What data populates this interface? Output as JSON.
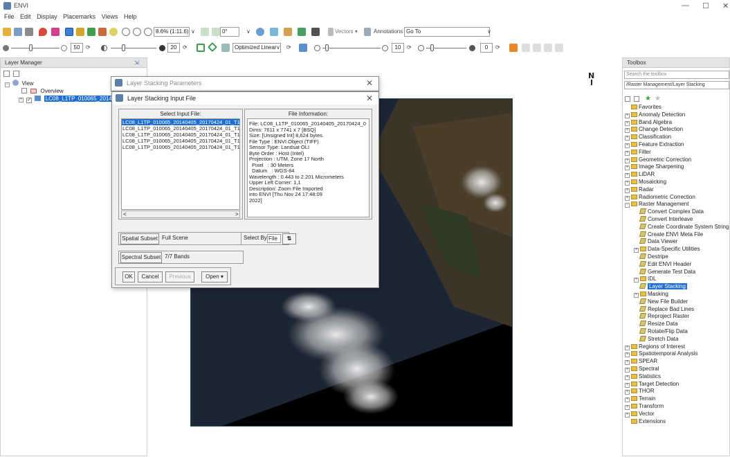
{
  "app": {
    "title": "ENVI",
    "minimize": "—",
    "maximize": "☐",
    "close": "✕"
  },
  "menu": [
    "File",
    "Edit",
    "Display",
    "Placemarks",
    "Views",
    "Help"
  ],
  "toolbar": {
    "zoom_value": "8.6% (1:11.6)",
    "rotation_value": "0°",
    "vectors_label": "Vectors ▾",
    "annotations_label": "Annotations ▾",
    "goto_value": "Go To",
    "brightness_value": "50",
    "contrast_value": "20",
    "stretch_value": "Optimized Linear",
    "sharpen_value": "10",
    "transparency_value": "0"
  },
  "layer_manager": {
    "title": "Layer Manager",
    "root": "View",
    "overview": "Overview",
    "layer": "LC08_L1TP_010065_20140"
  },
  "north_arrow": "N",
  "toolbox": {
    "title": "Toolbox",
    "search_placeholder": "Search the toolbox",
    "path": "/Raster Management/Layer Stacking",
    "items": [
      {
        "label": "Favorites",
        "indent": 0,
        "kind": "folder",
        "pm": ""
      },
      {
        "label": "Anomaly Detection",
        "indent": 0,
        "kind": "folder",
        "pm": "+"
      },
      {
        "label": "Band Algebra",
        "indent": 0,
        "kind": "folder",
        "pm": "+"
      },
      {
        "label": "Change Detection",
        "indent": 0,
        "kind": "folder",
        "pm": "+"
      },
      {
        "label": "Classification",
        "indent": 0,
        "kind": "folder",
        "pm": "+"
      },
      {
        "label": "Feature Extraction",
        "indent": 0,
        "kind": "folder",
        "pm": "+"
      },
      {
        "label": "Filter",
        "indent": 0,
        "kind": "folder",
        "pm": "+"
      },
      {
        "label": "Geometric Correction",
        "indent": 0,
        "kind": "folder",
        "pm": "+"
      },
      {
        "label": "Image Sharpening",
        "indent": 0,
        "kind": "folder",
        "pm": "+"
      },
      {
        "label": "LiDAR",
        "indent": 0,
        "kind": "folder",
        "pm": "+"
      },
      {
        "label": "Mosaicking",
        "indent": 0,
        "kind": "folder",
        "pm": "+"
      },
      {
        "label": "Radar",
        "indent": 0,
        "kind": "folder",
        "pm": "+"
      },
      {
        "label": "Radiometric Correction",
        "indent": 0,
        "kind": "folder",
        "pm": "+"
      },
      {
        "label": "Raster Management",
        "indent": 0,
        "kind": "folder",
        "pm": "−"
      },
      {
        "label": "Convert Complex Data",
        "indent": 1,
        "kind": "tool",
        "pm": ""
      },
      {
        "label": "Convert Interleave",
        "indent": 1,
        "kind": "tool",
        "pm": ""
      },
      {
        "label": "Create Coordinate System String",
        "indent": 1,
        "kind": "tool",
        "pm": ""
      },
      {
        "label": "Create ENVI Meta File",
        "indent": 1,
        "kind": "tool",
        "pm": ""
      },
      {
        "label": "Data Viewer",
        "indent": 1,
        "kind": "tool",
        "pm": ""
      },
      {
        "label": "Data-Specific Utilities",
        "indent": 1,
        "kind": "folder",
        "pm": "+"
      },
      {
        "label": "Destripe",
        "indent": 1,
        "kind": "tool",
        "pm": ""
      },
      {
        "label": "Edit ENVI Header",
        "indent": 1,
        "kind": "tool",
        "pm": ""
      },
      {
        "label": "Generate Test Data",
        "indent": 1,
        "kind": "tool",
        "pm": ""
      },
      {
        "label": "IDL",
        "indent": 1,
        "kind": "folder",
        "pm": "+"
      },
      {
        "label": "Layer Stacking",
        "indent": 1,
        "kind": "tool",
        "pm": "",
        "selected": true
      },
      {
        "label": "Masking",
        "indent": 1,
        "kind": "folder",
        "pm": "+"
      },
      {
        "label": "New File Builder",
        "indent": 1,
        "kind": "tool",
        "pm": ""
      },
      {
        "label": "Replace Bad Lines",
        "indent": 1,
        "kind": "tool",
        "pm": ""
      },
      {
        "label": "Reproject Raster",
        "indent": 1,
        "kind": "tool",
        "pm": ""
      },
      {
        "label": "Resize Data",
        "indent": 1,
        "kind": "tool",
        "pm": ""
      },
      {
        "label": "Rotate/Flip Data",
        "indent": 1,
        "kind": "tool",
        "pm": ""
      },
      {
        "label": "Stretch Data",
        "indent": 1,
        "kind": "tool",
        "pm": ""
      },
      {
        "label": "Regions of Interest",
        "indent": 0,
        "kind": "folder",
        "pm": "+"
      },
      {
        "label": "Spatiotemporal Analysis",
        "indent": 0,
        "kind": "folder",
        "pm": "+"
      },
      {
        "label": "SPEAR",
        "indent": 0,
        "kind": "folder",
        "pm": "+"
      },
      {
        "label": "Spectral",
        "indent": 0,
        "kind": "folder",
        "pm": "+"
      },
      {
        "label": "Statistics",
        "indent": 0,
        "kind": "folder",
        "pm": "+"
      },
      {
        "label": "Target Detection",
        "indent": 0,
        "kind": "folder",
        "pm": "+"
      },
      {
        "label": "THOR",
        "indent": 0,
        "kind": "folder",
        "pm": "+"
      },
      {
        "label": "Terrain",
        "indent": 0,
        "kind": "folder",
        "pm": "+"
      },
      {
        "label": "Transform",
        "indent": 0,
        "kind": "folder",
        "pm": "+"
      },
      {
        "label": "Vector",
        "indent": 0,
        "kind": "folder",
        "pm": "+"
      },
      {
        "label": "Extensions",
        "indent": 0,
        "kind": "folder",
        "pm": ""
      }
    ]
  },
  "stack_params": {
    "title": "Layer Stacking Parameters",
    "close": "✕"
  },
  "input_dialog": {
    "title": "Layer Stacking Input File",
    "close": "✕",
    "select_header": "Select Input File:",
    "files": [
      "LC08_L1TP_010065_20140405_20170424_01_T1",
      "LC08_L1TP_010065_20140405_20170424_01_T1",
      "LC08_L1TP_010065_20140405_20170424_01_T1",
      "LC08_L1TP_010065_20140405_20170424_01_T1",
      "LC08_L1TP_010065_20140405_20170424_01_T1"
    ],
    "info_header": "File Information:",
    "info_lines": [
      "File: LC08_L1TP_010065_20140405_20170424_0",
      "Dims: 7611 x 7741 x 7 [BSQ]",
      "Size: [Unsigned Int] 8,624 bytes.",
      "File Type : ENVI Object (TIFF)",
      "Sensor Type: Landsat OLI",
      "Byte Order : Host (Intel)",
      "Projection : UTM, Zone 17 North",
      "  Pixel   : 30 Meters",
      "  Datum   : WGS-84",
      "Wavelength : 0.443 to 2.201 Micrometers",
      "Upper Left Corner: 1,1",
      "Description: Zoom File Imported",
      "into ENVI [Thu Nov 24 17:48:09",
      "2022]"
    ],
    "spatial_label": "Spatial Subset",
    "spatial_value": "Full Scene",
    "select_by_label": "Select By",
    "select_by_value": "File",
    "spectral_label": "Spectral Subset",
    "spectral_value": "7/7 Bands",
    "ok": "OK",
    "cancel": "Cancel",
    "previous": "Previous",
    "open": "Open ▾"
  }
}
